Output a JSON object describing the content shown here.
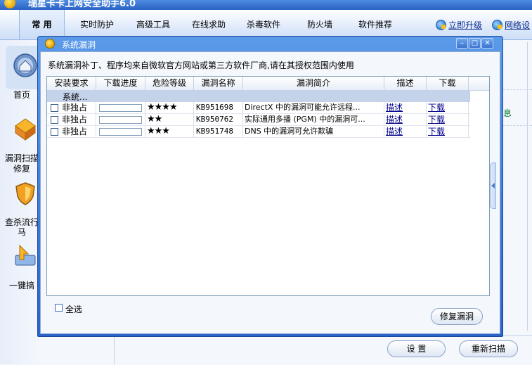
{
  "app": {
    "title": "瑞星卡卡上网安全助手6.0"
  },
  "nav": {
    "tabs": [
      "常 用",
      "实时防护",
      "高级工具",
      "在线求助",
      "杀毒软件",
      "防火墙",
      "软件推荐"
    ],
    "upgrade_label": "立即升级",
    "network_label": "网络设"
  },
  "sidebar": {
    "items": [
      {
        "label": "首页"
      },
      {
        "label": "漏洞扫描",
        "label2": "修复"
      },
      {
        "label": "查杀流行",
        "label2": "马"
      },
      {
        "label": "一键搞"
      }
    ]
  },
  "right_panel": {
    "link": "息"
  },
  "bottom": {
    "settings_label": "设 置",
    "rescan_label": "重新扫描"
  },
  "dialog": {
    "title": "系统漏洞",
    "intro": "系统漏洞补丁、程序均来自微软官方网站或第三方软件厂商,请在其授权范围内使用",
    "columns": [
      "安装要求",
      "下载进度",
      "危险等级",
      "漏洞名称",
      "漏洞简介",
      "描述",
      "下载"
    ],
    "group_label": "系统...",
    "rows": [
      {
        "install": "非独占",
        "progress": 0,
        "danger": "★★★★",
        "name": "KB951698",
        "brief": "DirectX 中的漏洞可能允许远程...",
        "desc": "描述",
        "download": "下载"
      },
      {
        "install": "非独占",
        "progress": 0,
        "danger": "★★",
        "name": "KB950762",
        "brief": "实际通用多播 (PGM) 中的漏洞可...",
        "desc": "描述",
        "download": "下载"
      },
      {
        "install": "非独占",
        "progress": 0,
        "danger": "★★★",
        "name": "KB951748",
        "brief": "DNS 中的漏洞可允许欺骗",
        "desc": "描述",
        "download": "下载"
      }
    ],
    "select_all_label": "全选",
    "repair_label": "修复漏洞"
  }
}
